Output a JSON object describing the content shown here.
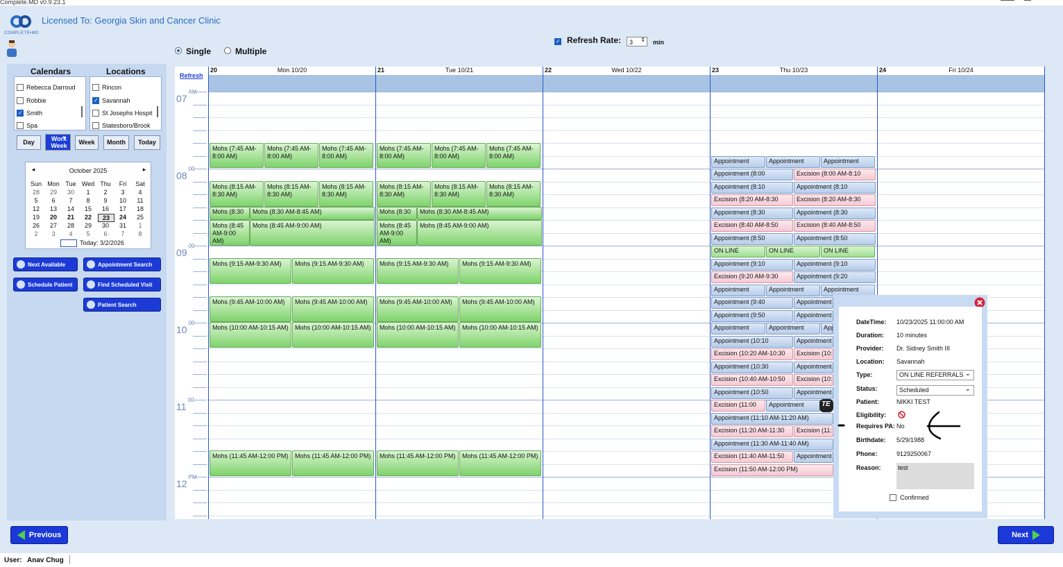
{
  "app": {
    "title": "Complete.MD v0.9.23.1",
    "license": "Licensed To: Georgia Skin and Cancer Clinic",
    "brand": "COMPLETE•MD"
  },
  "mode": {
    "single": "Single",
    "multiple": "Multiple"
  },
  "refresh": {
    "label": "Refresh Rate:",
    "value": "3",
    "unit": "min",
    "link": "Refresh"
  },
  "left": {
    "calendars_header": "Calendars",
    "locations_header": "Locations",
    "calendars": [
      {
        "name": "Rebecca Darroud",
        "checked": false
      },
      {
        "name": "Robbie",
        "checked": false
      },
      {
        "name": "Smith",
        "checked": true
      },
      {
        "name": "Spa",
        "checked": false
      }
    ],
    "locations": [
      {
        "name": "Rincon",
        "checked": false
      },
      {
        "name": "Savannah",
        "checked": true
      },
      {
        "name": "St Josephs Hospit",
        "checked": false
      },
      {
        "name": "Statesboro/Brook",
        "checked": false
      }
    ],
    "views": {
      "day": "Day",
      "work_week_1": "Work",
      "work_week_2": "Week",
      "week": "Week",
      "month": "Month",
      "today": "Today"
    },
    "mini": {
      "month": "October 2025",
      "dow": [
        "Sun",
        "Mon",
        "Tue",
        "Wed",
        "Thu",
        "Fri",
        "Sat"
      ],
      "weeks": [
        [
          "28",
          "29",
          "30",
          "1",
          "2",
          "3",
          "4"
        ],
        [
          "5",
          "6",
          "7",
          "8",
          "9",
          "10",
          "11"
        ],
        [
          "12",
          "13",
          "14",
          "15",
          "16",
          "17",
          "18"
        ],
        [
          "19",
          "20",
          "21",
          "22",
          "23",
          "24",
          "25"
        ],
        [
          "26",
          "27",
          "28",
          "29",
          "30",
          "31",
          "1"
        ],
        [
          "2",
          "3",
          "4",
          "5",
          "6",
          "7",
          "8"
        ]
      ],
      "today": "Today: 3/2/2026"
    },
    "actions": {
      "next_available": "Next Available",
      "appointment_search": "Appointment Search",
      "schedule_patient": "Schedule Patient",
      "find_scheduled": "Find Scheduled Visit",
      "patient_search": "Patient Search"
    }
  },
  "days": [
    {
      "num": "20",
      "label": "Mon 10/20"
    },
    {
      "num": "21",
      "label": "Tue 10/21"
    },
    {
      "num": "22",
      "label": "Wed 10/22"
    },
    {
      "num": "23",
      "label": "Thu 10/23"
    },
    {
      "num": "24",
      "label": "Fri 10/24"
    }
  ],
  "hours": [
    {
      "h": "07",
      "s": "AM"
    },
    {
      "h": "08",
      "s": "00"
    },
    {
      "h": "09",
      "s": "00"
    },
    {
      "h": "10",
      "s": "00"
    },
    {
      "h": "11",
      "s": "00"
    },
    {
      "h": "12",
      "s": "PM"
    }
  ],
  "events": {
    "mohs_745": "Mohs (7:45 AM-8:00 AM)",
    "mohs_815": "Mohs (8:15 AM-8:30 AM)",
    "mohs_830": "Mohs (8:30",
    "mohs_830_845": "Mohs (8:30 AM-8:45 AM)",
    "mohs_845": "Mohs (8:45 AM-9:00 AM)",
    "mohs_845_900": "Mohs (8:45 AM-9:00 AM)",
    "mohs_915": "Mohs (9:15 AM-9:30 AM)",
    "mohs_945": "Mohs (9:45 AM-10:00 AM)",
    "mohs_1000": "Mohs (10:00 AM-10:15 AM)",
    "mohs_1145": "Mohs (11:45 AM-12:00 PM)",
    "appt": "Appointment",
    "appt_800": "Appointment (8:00",
    "exc_800": "Excision (8:00 AM-8:10",
    "appt_810": "Appointment (8:10",
    "exc_820": "Excision (8:20 AM-8:30",
    "appt_830": "Appointment (8:30",
    "exc_840": "Excision (8:40 AM-8:50",
    "appt_850": "Appointment (8:50",
    "online": "ON LINE",
    "appt_910": "Appointment (9:10",
    "exc_920": "Excision (9:20 AM-9:30",
    "appt_920": "Appointment (9:20",
    "appt_940": "Appointment (9:40",
    "appt_950": "Appointment (9:50",
    "appt_1010": "Appointment (10:10",
    "exc_1020": "Excision (10:20 AM-10:30",
    "exc_1020s": "Excision (10:",
    "appt_1030": "Appointment (10:30",
    "exc_1040": "Excision (10:40 AM-10:50",
    "exc_1040s": "Excision (10:",
    "appt_1050": "Appointment (10:50",
    "exc_1100": "Excision (11:00",
    "te": "TE",
    "appt_1110": "Appointment (11:10 AM-11:20 AM)",
    "exc_1120": "Excision (11:20 AM-11:30",
    "exc_1120s": "Excision (11:",
    "appt_1130": "Appointment (11:30 AM-11:40 AM)",
    "exc_1140": "Excision (11:40 AM-11:50",
    "exc_1150": "Excision (11:50 AM-12:00 PM)"
  },
  "popup": {
    "datetime_k": "DateTime:",
    "datetime_v": "10/23/2025 11:00:00 AM",
    "duration_k": "Duration:",
    "duration_v": "10 minutes",
    "provider_k": "Provider:",
    "provider_v": "Dr. Sidney Smith III",
    "location_k": "Location:",
    "location_v": "Savannah",
    "type_k": "Type:",
    "type_v": "ON LINE REFERRALS",
    "status_k": "Status:",
    "status_v": "Scheduled",
    "patient_k": "Patient:",
    "patient_v": "NIKKI  TEST",
    "elig_k": "Eligibility:",
    "pa_k": "Requires PA:",
    "pa_v": "No",
    "birth_k": "Birthdate:",
    "birth_v": "5/29/1988",
    "phone_k": "Phone:",
    "phone_v": "9129250067",
    "reason_k": "Reason:",
    "reason_v": "test",
    "confirmed": "Confirmed"
  },
  "nav": {
    "previous": "Previous",
    "next": "Next"
  },
  "status": {
    "user_label": "User:",
    "user_name": "Anav Chug"
  }
}
